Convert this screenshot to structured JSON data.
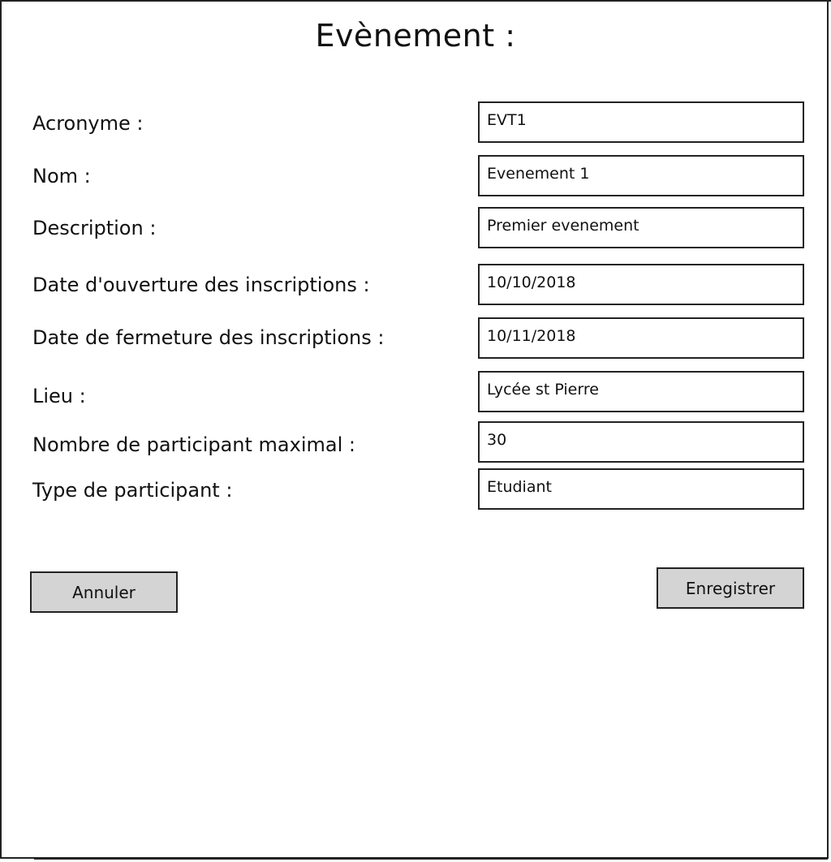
{
  "form": {
    "title": "Evènement :",
    "fields": [
      {
        "label": "Acronyme :",
        "value": "EVT1"
      },
      {
        "label": "Nom :",
        "value": "Evenement 1"
      },
      {
        "label": "Description :",
        "value": "Premier evenement"
      },
      {
        "label": "Date d'ouverture des inscriptions :",
        "value": "10/10/2018"
      },
      {
        "label": "Date de fermeture des inscriptions :",
        "value": "10/11/2018"
      },
      {
        "label": "Lieu :",
        "value": "Lycée st Pierre"
      },
      {
        "label": "Nombre de participant maximal :",
        "value": "30"
      },
      {
        "label": "Type de participant :",
        "value": "Etudiant"
      }
    ],
    "buttons": {
      "cancel_label": "Annuler",
      "save_label": "Enregistrer"
    }
  },
  "colors": {
    "border": "#222222",
    "button_bg": "#d4d4d4",
    "background": "#ffffff"
  }
}
